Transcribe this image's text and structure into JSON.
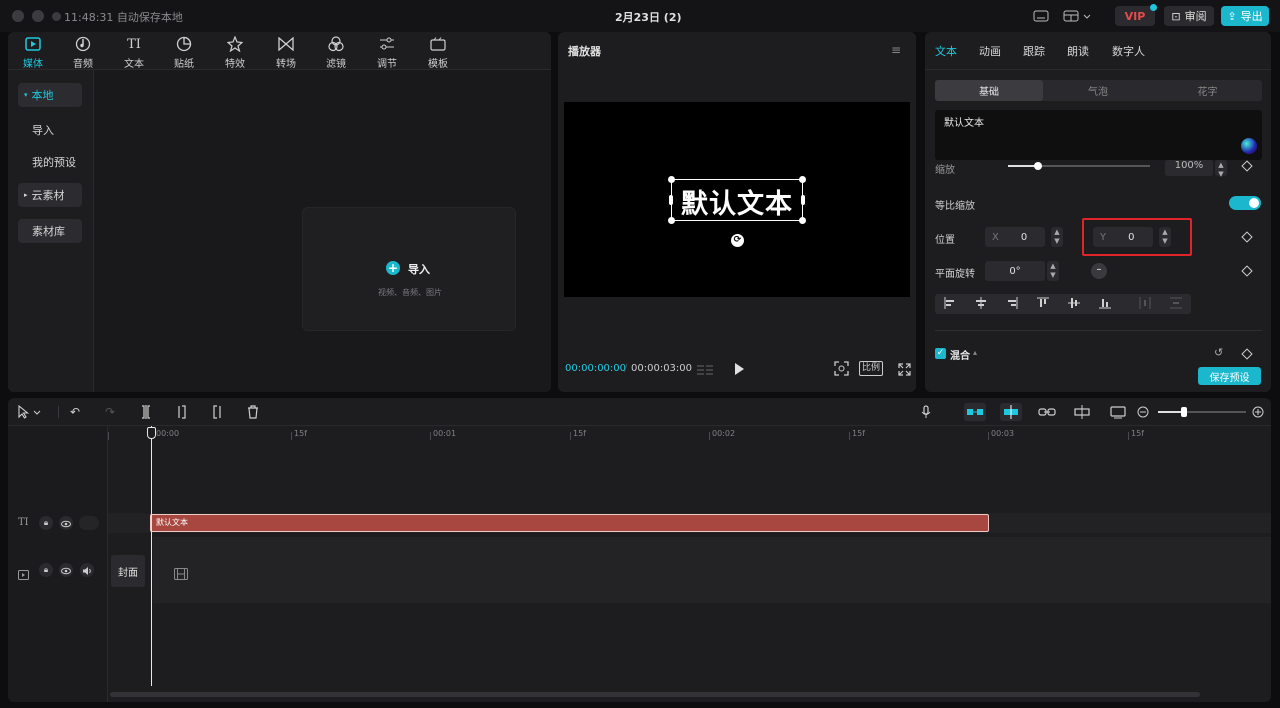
{
  "titlebar": {
    "autosave": "11:48:31 自动保存本地",
    "project_title": "2月23日 (2)",
    "vip": "VIP",
    "review": "审阅",
    "export": "导出"
  },
  "media_toolbar": [
    {
      "label": "媒体",
      "icon": "media-icon",
      "glyph": "▶"
    },
    {
      "label": "音频",
      "icon": "audio-icon",
      "glyph": "♪"
    },
    {
      "label": "文本",
      "icon": "text-icon",
      "glyph": "TI"
    },
    {
      "label": "贴纸",
      "icon": "sticker-icon",
      "glyph": "◔"
    },
    {
      "label": "特效",
      "icon": "effects-icon",
      "glyph": "✧"
    },
    {
      "label": "转场",
      "icon": "transition-icon",
      "glyph": "⋈"
    },
    {
      "label": "滤镜",
      "icon": "filter-icon",
      "glyph": "❀"
    },
    {
      "label": "调节",
      "icon": "adjust-icon",
      "glyph": "☷"
    },
    {
      "label": "模板",
      "icon": "template-icon",
      "glyph": "▭"
    }
  ],
  "media_sidebar": {
    "local": "本地",
    "import": "导入",
    "presets": "我的预设",
    "cloud": "云素材",
    "library": "素材库"
  },
  "import_zone": {
    "label": "导入",
    "hint": "视频、音频、图片"
  },
  "player": {
    "title": "播放器",
    "canvas_text": "默认文本",
    "time_current": "00:00:00:00",
    "time_total": "00:00:03:00",
    "ratio": "比例"
  },
  "props": {
    "tabs": [
      "文本",
      "动画",
      "跟踪",
      "朗读",
      "数字人"
    ],
    "subtabs": [
      "基础",
      "气泡",
      "花字"
    ],
    "text_value": "默认文本",
    "scale_label": "缩放",
    "scale_value": "100%",
    "uniform_scale_label": "等比缩放",
    "position_label": "位置",
    "x_prefix": "X",
    "x_value": "0",
    "y_prefix": "Y",
    "y_value": "0",
    "rotation_label": "平面旋转",
    "rotation_value": "0°",
    "blend_label": "混合",
    "save_preset": "保存预设"
  },
  "timeline": {
    "ruler": [
      "00:00",
      "15f",
      "00:01",
      "15f",
      "00:02",
      "15f",
      "00:03",
      "15f"
    ],
    "text_clip": "默认文本",
    "cover": "封面"
  },
  "colors": {
    "accent": "#1bb7cc",
    "clip": "#a8473f",
    "highlight": "#e0242a"
  }
}
